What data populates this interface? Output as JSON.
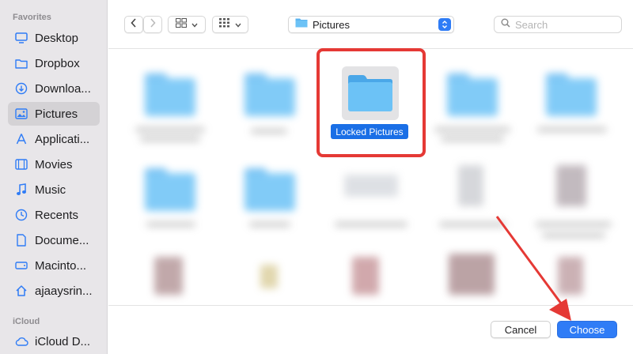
{
  "sidebar": {
    "favorites_heading": "Favorites",
    "icloud_heading": "iCloud",
    "items": [
      {
        "label": "Desktop",
        "icon": "desktop-icon"
      },
      {
        "label": "Dropbox",
        "icon": "folder-icon"
      },
      {
        "label": "Downloa...",
        "icon": "download-icon"
      },
      {
        "label": "Pictures",
        "icon": "photo-icon",
        "selected": true
      },
      {
        "label": "Applicati...",
        "icon": "applications-icon"
      },
      {
        "label": "Movies",
        "icon": "film-icon"
      },
      {
        "label": "Music",
        "icon": "music-note-icon"
      },
      {
        "label": "Recents",
        "icon": "clock-icon"
      },
      {
        "label": "Docume...",
        "icon": "document-icon"
      },
      {
        "label": "Macinto...",
        "icon": "hard-drive-icon"
      },
      {
        "label": "ajaaysrin...",
        "icon": "home-icon"
      }
    ],
    "icloud_items": [
      {
        "label": "iCloud D...",
        "icon": "cloud-icon"
      }
    ]
  },
  "toolbar": {
    "path_label": "Pictures",
    "search_placeholder": "Search"
  },
  "grid": {
    "selected_item_label": "Locked Pictures"
  },
  "footer": {
    "cancel_label": "Cancel",
    "choose_label": "Choose"
  },
  "colors": {
    "accent": "#2f7cf6",
    "selection": "#1a6fe6",
    "annotation": "#e53935",
    "folder": "#6cc2f6"
  }
}
